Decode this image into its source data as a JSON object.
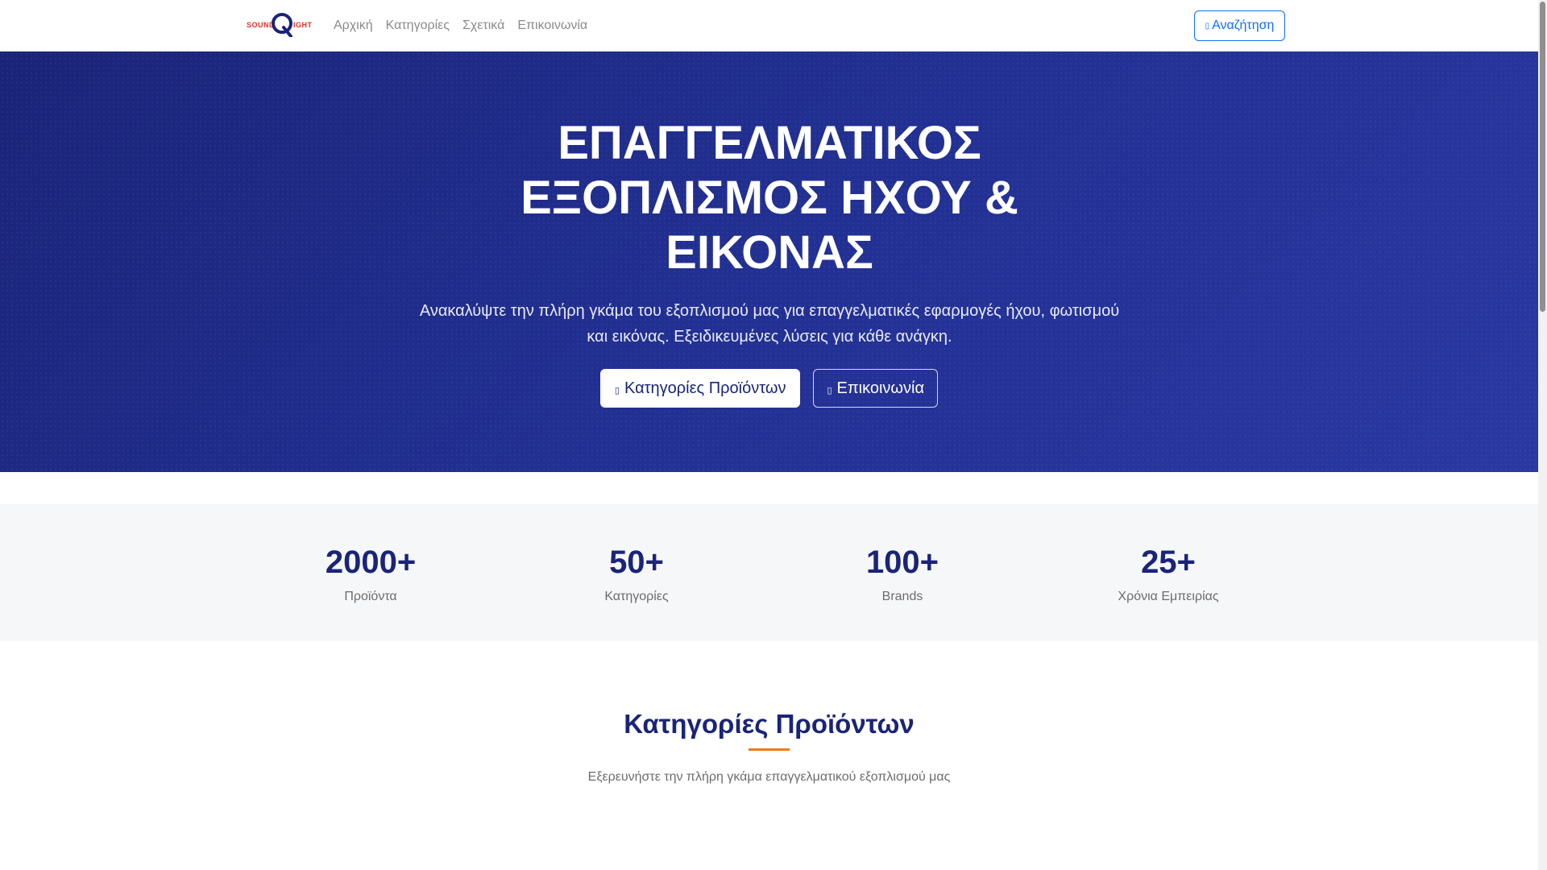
{
  "navbar": {
    "logo": {
      "left_word": "SOUND",
      "right_word": "IGHT",
      "mark_letter": "Q"
    },
    "links": [
      "Αρχική",
      "Κατηγορίες",
      "Σχετικά",
      "Επικοινωνία"
    ],
    "search_label": "Αναζήτηση",
    "search_icon": "search-icon"
  },
  "hero": {
    "title": "ΕΠΑΓΓΕΛΜΑΤΙΚΟΣ ΕΞΟΠΛΙΣΜΟΣ ΗΧΟΥ & ΕΙΚΟΝΑΣ",
    "subtitle": "Ανακαλύψτε την πλήρη γκάμα του εξοπλισμού μας για επαγγελματικές εφαρμογές ήχου, φωτισμού και εικόνας. Εξειδικευμένες λύσεις για κάθε ανάγκη.",
    "primary_button": "Κατηγορίες Προϊόντων",
    "secondary_button": "Επικοινωνία",
    "colors": {
      "gradient_start": "#1a2478",
      "gradient_end": "#2a38a2"
    }
  },
  "stats": [
    {
      "value": "2000+",
      "label": "Προϊόντα"
    },
    {
      "value": "50+",
      "label": "Κατηγορίες"
    },
    {
      "value": "100+",
      "label": "Brands"
    },
    {
      "value": "25+",
      "label": "Χρόνια Εμπειρίας"
    }
  ],
  "categories": {
    "title": "Κατηγορίες Προϊόντων",
    "subtitle": "Εξερευνήστε την πλήρη γκάμα επαγγελματικού εξοπλισμού μας",
    "accent_color": "#f07a16"
  },
  "colors": {
    "brand": "#1a2478",
    "link": "#0d6efd",
    "logo_red": "#e0302a"
  }
}
